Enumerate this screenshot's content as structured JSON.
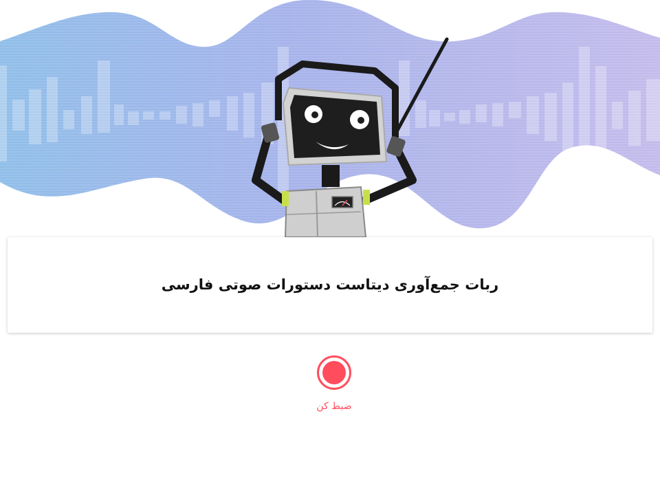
{
  "hero": {
    "illustration": "robot-with-headphones-over-sound-wave"
  },
  "card": {
    "title": "ربات جمع‌آوری دیتاست دستورات صوتی فارسی"
  },
  "record": {
    "label": "ضبط کن",
    "icon": "record-icon"
  },
  "colors": {
    "accent": "#ff4d5e",
    "wave_left": "#8fbde9",
    "wave_right": "#c0b8ea"
  }
}
